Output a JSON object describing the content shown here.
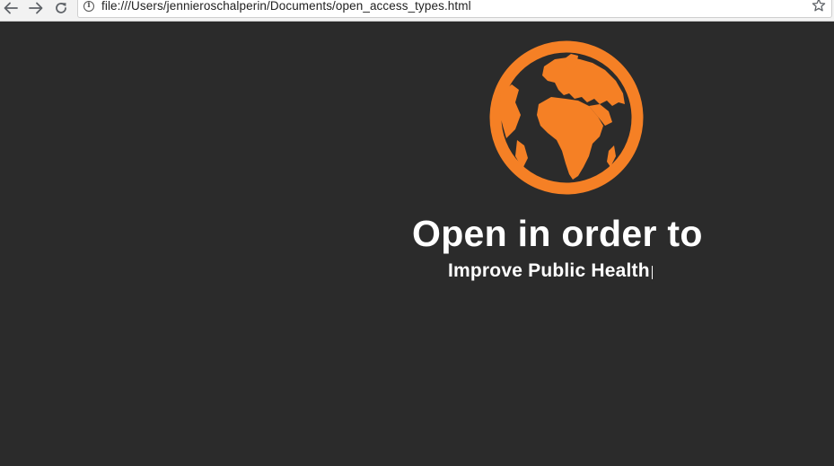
{
  "browser": {
    "url": "file:///Users/jennieroschalperin/Documents/open_access_types.html",
    "icons": {
      "back": "arrow-left-icon",
      "forward": "arrow-right-icon",
      "reload": "reload-icon",
      "info": "info-icon",
      "bookmark": "star-icon"
    }
  },
  "page": {
    "logo_icon": "globe-icon",
    "headline": "Open in order to",
    "typed_text": "Improve Public Health",
    "colors": {
      "background": "#2b2b2b",
      "accent": "#f58025",
      "text": "#ffffff"
    }
  }
}
